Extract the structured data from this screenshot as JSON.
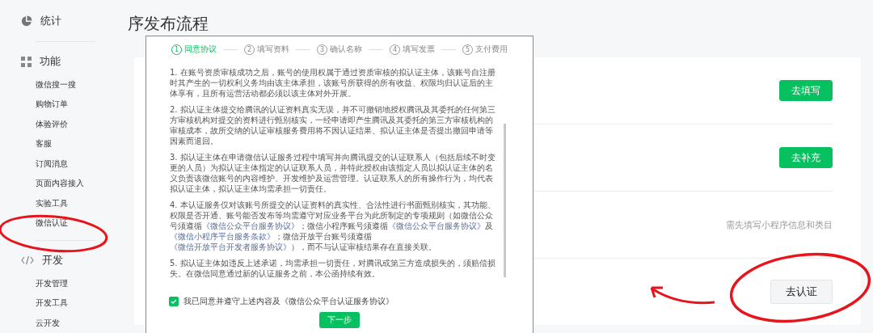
{
  "sidebar": {
    "groups": [
      {
        "kind": "stats",
        "title": "统计"
      },
      {
        "kind": "features",
        "title": "功能",
        "items": [
          "微信搜一搜",
          "购物订单",
          "体验评价",
          "客服",
          "订阅消息",
          "页面内容接入",
          "实验工具",
          "微信认证"
        ]
      },
      {
        "kind": "dev",
        "title": "开发",
        "items": [
          "开发管理",
          "开发工具",
          "云开发"
        ]
      }
    ]
  },
  "page_title": "序发布流程",
  "card": {
    "rows": [
      {
        "kind": "primary",
        "label": "去填写"
      },
      {
        "kind": "primary",
        "label": "去补充"
      },
      {
        "kind": "note",
        "text": "需先填写小程序信息和类目"
      },
      {
        "kind": "secondary",
        "label": "去认证"
      }
    ]
  },
  "dialog": {
    "steps": [
      {
        "number": "1",
        "label": "同意协议",
        "selected": true
      },
      {
        "number": "2",
        "label": "填写资料",
        "selected": false
      },
      {
        "number": "3",
        "label": "确认名称",
        "selected": false
      },
      {
        "number": "4",
        "label": "填写发票",
        "selected": false
      },
      {
        "number": "5",
        "label": "支付费用",
        "selected": false
      }
    ],
    "paragraphs": [
      [
        {
          "kind": "text",
          "text": "1. 在账号资质审核成功之后，账号的使用权属于通过资质审核的拟认证主体，该账号自注册时其产生的一切权利义务均由该主体承担，该账号所获得的所有收益、权限均归认证后的主体享有，且所有运营活动都必须以该主体对外开展。"
        }
      ],
      [
        {
          "kind": "text",
          "text": "2. 拟认证主体提交给腾讯的认证资料真实无误，并不可撤销地授权腾讯及其委托的任何第三方审核机构对提交的资料进行甄别核实，一经申请即产生腾讯及其委托的第三方审核机构的审核成本，故所交纳的认证审核服务费用将不因认证结果、拟认证主体是否提出撤回申请等因素而退回。"
        }
      ],
      [
        {
          "kind": "text",
          "text": "3. 拟认证主体在申请微信认证服务过程中填写并向腾讯提交的认证联系人（包括后续不时变更的人员）为拟认证主体指定的认证联系人员，并特此授权由该指定人员以拟认证主体的名义负责该微信账号的内容维护、开发维护及运营管理。认证联系人的所有操作行为，均代表拟认证主体，拟认证主体均需承担一切责任。"
        }
      ],
      [
        {
          "kind": "text",
          "text": "4. 本认证服务仅对该账号所提交的认证资料的真实性、合法性进行书面甄别核实，其功能、权限是否开通、账号能否发布等均需遵守对应业务平台为此所制定的专项规则（如微信公众号须遵循"
        },
        {
          "kind": "link",
          "text": "《微信公众平台服务协议》"
        },
        {
          "kind": "text",
          "text": "；微信小程序账号须遵循"
        },
        {
          "kind": "link",
          "text": "《微信公众平台服务协议》"
        },
        {
          "kind": "text",
          "text": "及"
        },
        {
          "kind": "link",
          "text": "《微信小程序平台服务条款》"
        },
        {
          "kind": "text",
          "text": "；微信开放平台账号须遵循"
        },
        {
          "kind": "link",
          "text": "《微信开放平台开发者服务协议》"
        },
        {
          "kind": "text",
          "text": "），而不与认证审核结果存在直接关联。"
        }
      ],
      [
        {
          "kind": "text",
          "text": "5. 拟认证主体如违反上述承诺，均需承担一切责任，对腾讯或第三方造成损失的，须赔偿损失。在微信同意通过新的认证服务之前，本公函持续有效。"
        }
      ]
    ],
    "agree": {
      "checked": true,
      "label": "我已同意并遵守上述内容及《微信公众平台认证服务协议》"
    },
    "next_button": "下一步"
  }
}
